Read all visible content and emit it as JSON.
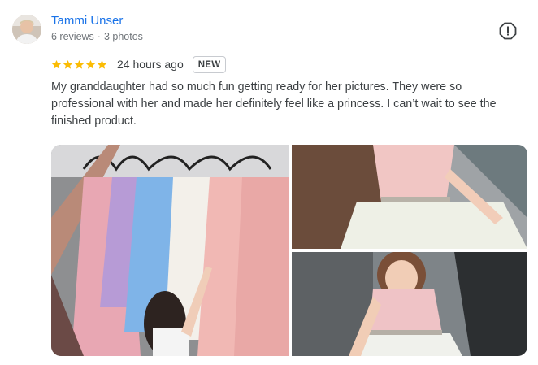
{
  "reviewer": {
    "name": "Tammi Unser",
    "reviews": "6 reviews",
    "separator": "·",
    "photos": "3 photos"
  },
  "review": {
    "rating": 5,
    "max_rating": 5,
    "star_color": "#fbbc04",
    "time": "24 hours ago",
    "badge": "NEW",
    "text": "My granddaughter had so much fun getting ready for her pictures. They were so professional with her and made her definitely feel like a princess. I can’t wait to see the finished product."
  },
  "icons": {
    "report": "report-flag-icon",
    "star": "star-icon"
  },
  "colors": {
    "name_link": "#1a73e8",
    "meta_text": "#70757a",
    "body_text": "#3c4043"
  }
}
